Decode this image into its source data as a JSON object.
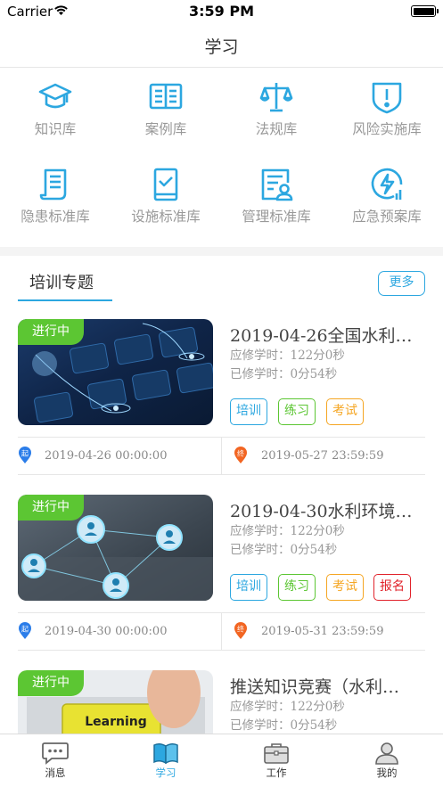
{
  "status_bar": {
    "carrier": "Carrier",
    "time": "3:59 PM"
  },
  "nav": {
    "title": "学习"
  },
  "grid": [
    {
      "label": "知识库",
      "icon": "graduation-cap-icon"
    },
    {
      "label": "案例库",
      "icon": "open-book-icon"
    },
    {
      "label": "法规库",
      "icon": "scales-icon"
    },
    {
      "label": "风险实施库",
      "icon": "shield-alert-icon"
    },
    {
      "label": "隐患标准库",
      "icon": "document-list-icon"
    },
    {
      "label": "设施标准库",
      "icon": "phone-check-icon"
    },
    {
      "label": "管理标准库",
      "icon": "document-user-icon"
    },
    {
      "label": "应急预案库",
      "icon": "lightning-chart-icon"
    }
  ],
  "section": {
    "title": "培训专题",
    "more": "更多"
  },
  "cards": [
    {
      "status": "进行中",
      "title": "2019-04-26全国水利…",
      "required": "应修学时：122分0秒",
      "completed": "已修学时：0分54秒",
      "tags": [
        "培训",
        "练习",
        "考试"
      ],
      "start_badge": "起",
      "start": "2019-04-26 00:00:00",
      "end_badge": "终",
      "end": "2019-05-27 23:59:59"
    },
    {
      "status": "进行中",
      "title": "2019-04-30水利环境…",
      "required": "应修学时：122分0秒",
      "completed": "已修学时：0分54秒",
      "tags": [
        "培训",
        "练习",
        "考试",
        "报名"
      ],
      "start_badge": "起",
      "start": "2019-04-30 00:00:00",
      "end_badge": "终",
      "end": "2019-05-31 23:59:59"
    },
    {
      "status": "进行中",
      "title": "推送知识竞赛（水利…",
      "required": "应修学时：122分0秒",
      "completed": "已修学时：0分54秒",
      "thumb_text": "Learning"
    }
  ],
  "tabs": [
    {
      "label": "消息",
      "active": false
    },
    {
      "label": "学习",
      "active": true
    },
    {
      "label": "工作",
      "active": false
    },
    {
      "label": "我的",
      "active": false
    }
  ],
  "colors": {
    "accent": "#2ca7e0",
    "status_green": "#5cc633",
    "tag_orange": "#f5a623",
    "tag_red": "#e1232b",
    "pin_blue": "#2b7de9",
    "pin_orange": "#f26522"
  }
}
